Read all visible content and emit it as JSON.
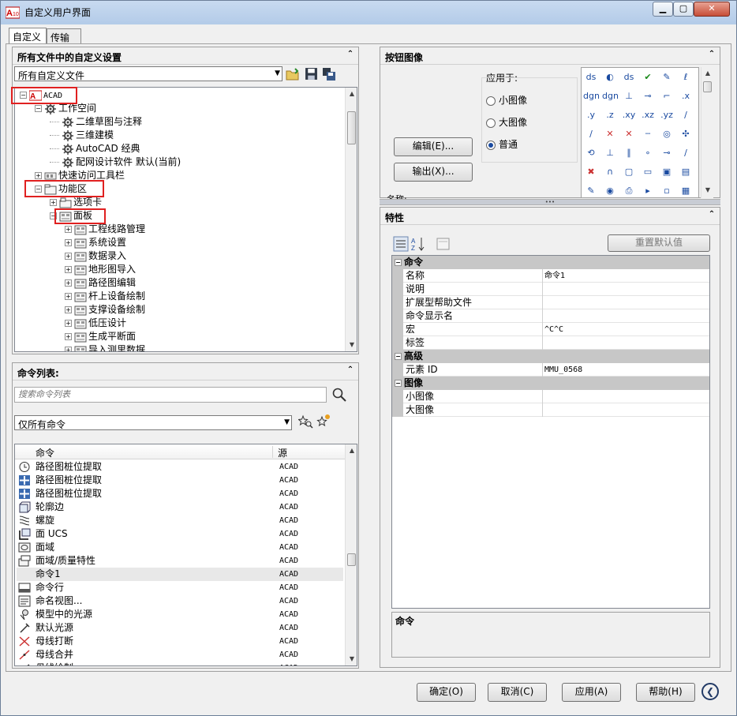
{
  "window": {
    "title": "自定义用户界面",
    "min_symbol": "▁",
    "max_symbol": "▢",
    "close_symbol": "✕"
  },
  "tabs": [
    {
      "label": "自定义",
      "active": true
    },
    {
      "label": "传输",
      "active": false
    }
  ],
  "customizations_panel": {
    "title": "所有文件中的自定义设置",
    "collapse_symbol": "⌃",
    "file_combo_value": "所有自定义文件",
    "tree": [
      {
        "label": "ACAD",
        "level": 0,
        "expander": "−",
        "icon": "acad-logo-icon"
      },
      {
        "label": "工作空间",
        "level": 1,
        "expander": "−",
        "icon": "gear-icon"
      },
      {
        "label": "二维草图与注释",
        "level": 2,
        "expander": "",
        "icon": "gear-icon"
      },
      {
        "label": "三维建模",
        "level": 2,
        "expander": "",
        "icon": "gear-icon"
      },
      {
        "label": "AutoCAD 经典",
        "level": 2,
        "expander": "",
        "icon": "gear-icon"
      },
      {
        "label": "配网设计软件 默认(当前)",
        "level": 2,
        "expander": "",
        "icon": "gear-icon"
      },
      {
        "label": "快速访问工具栏",
        "level": 1,
        "expander": "+",
        "icon": "toolbar-icon"
      },
      {
        "label": "功能区",
        "level": 1,
        "expander": "−",
        "icon": "folder-icon"
      },
      {
        "label": "选项卡",
        "level": 2,
        "expander": "+",
        "icon": "tab-icon"
      },
      {
        "label": "面板",
        "level": 2,
        "expander": "−",
        "icon": "panel-icon"
      },
      {
        "label": "工程线路管理",
        "level": 3,
        "expander": "+",
        "icon": "panel-icon"
      },
      {
        "label": "系统设置",
        "level": 3,
        "expander": "+",
        "icon": "panel-icon"
      },
      {
        "label": "数据录入",
        "level": 3,
        "expander": "+",
        "icon": "panel-icon"
      },
      {
        "label": "地形图导入",
        "level": 3,
        "expander": "+",
        "icon": "panel-icon"
      },
      {
        "label": "路径图编辑",
        "level": 3,
        "expander": "+",
        "icon": "panel-icon"
      },
      {
        "label": "杆上设备绘制",
        "level": 3,
        "expander": "+",
        "icon": "panel-icon"
      },
      {
        "label": "支撑设备绘制",
        "level": 3,
        "expander": "+",
        "icon": "panel-icon"
      },
      {
        "label": "低压设计",
        "level": 3,
        "expander": "+",
        "icon": "panel-icon"
      },
      {
        "label": "生成平断面",
        "level": 3,
        "expander": "+",
        "icon": "panel-icon"
      },
      {
        "label": "导入测里数据",
        "level": 3,
        "expander": "+",
        "icon": "panel-icon"
      }
    ]
  },
  "command_list_panel": {
    "title": "命令列表:",
    "collapse_symbol": "⌃",
    "search_placeholder": "搜索命令列表",
    "filter_value": "仅所有命令",
    "col_command": "命令",
    "col_source": "源",
    "rows": [
      {
        "name": "路径图桩位提取",
        "source": "ACAD",
        "icon": "clock-icon"
      },
      {
        "name": "路径图桩位提取",
        "source": "ACAD",
        "icon": "move-icon"
      },
      {
        "name": "路径图桩位提取",
        "source": "ACAD",
        "icon": "move-icon"
      },
      {
        "name": "轮廓边",
        "source": "ACAD",
        "icon": "box-icon"
      },
      {
        "name": "螺旋",
        "source": "ACAD",
        "icon": "helix-icon"
      },
      {
        "name": "面 UCS",
        "source": "ACAD",
        "icon": "ucs-icon"
      },
      {
        "name": "面域",
        "source": "ACAD",
        "icon": "region-icon"
      },
      {
        "name": "面域/质量特性",
        "source": "ACAD",
        "icon": "massprop-icon"
      },
      {
        "name": "命令1",
        "source": "ACAD",
        "icon": ""
      },
      {
        "name": "命令行",
        "source": "ACAD",
        "icon": "cmdline-icon"
      },
      {
        "name": "命名视图...",
        "source": "ACAD",
        "icon": "view-icon"
      },
      {
        "name": "模型中的光源",
        "source": "ACAD",
        "icon": "light-icon"
      },
      {
        "name": "默认光源",
        "source": "ACAD",
        "icon": "lamp-icon"
      },
      {
        "name": "母线打断",
        "source": "ACAD",
        "icon": "break-icon"
      },
      {
        "name": "母线合并",
        "source": "ACAD",
        "icon": "join-icon"
      },
      {
        "name": "母线绘制",
        "source": "ACAD",
        "icon": "draw-icon"
      }
    ],
    "selected_index": 8
  },
  "button_image_panel": {
    "title": "按钮图像",
    "collapse_symbol": "⌃",
    "apply_to_label": "应用于:",
    "options": [
      {
        "label": "小图像",
        "checked": false
      },
      {
        "label": "大图像",
        "checked": false
      },
      {
        "label": "普通",
        "checked": true
      }
    ],
    "edit_button": "编辑(E)...",
    "export_button": "输出(X)...",
    "name_label": "名称:",
    "splitter_symbol": "•••",
    "icon_grid": [
      [
        "ds",
        "◐",
        "ds",
        "✔",
        "✎",
        "ℓ"
      ],
      [
        "dgn",
        "dgn",
        "⊥",
        "⊸",
        "⌐",
        ".x"
      ],
      [
        ".y",
        ".z",
        ".xy",
        ".xz",
        ".yz",
        "∕"
      ],
      [
        "∕",
        "✕",
        "✕",
        "┄",
        "◎",
        "✣"
      ],
      [
        "⟲",
        "⊥",
        "∥",
        "∘",
        "⊸",
        "∕"
      ],
      [
        "✖",
        "∩",
        "▢",
        "▭",
        "▣",
        "▤"
      ],
      [
        "✎",
        "◉",
        "⎙",
        "▸",
        "▫",
        "▦"
      ]
    ]
  },
  "properties_panel": {
    "title": "特性",
    "collapse_symbol": "⌃",
    "reset_button": "重置默认值",
    "categories": [
      {
        "name": "命令",
        "props": [
          {
            "key": "名称",
            "value": "命令1"
          },
          {
            "key": "说明",
            "value": ""
          },
          {
            "key": "扩展型帮助文件",
            "value": ""
          },
          {
            "key": "命令显示名",
            "value": ""
          },
          {
            "key": "宏",
            "value": "^C^C"
          },
          {
            "key": "标签",
            "value": ""
          }
        ]
      },
      {
        "name": "高级",
        "props": [
          {
            "key": "元素 ID",
            "value": "MMU_0568"
          }
        ]
      },
      {
        "name": "图像",
        "props": [
          {
            "key": "小图像",
            "value": ""
          },
          {
            "key": "大图像",
            "value": ""
          }
        ]
      }
    ],
    "description_title": "命令"
  },
  "footer": {
    "ok": "确定(O)",
    "cancel": "取消(C)",
    "apply": "应用(A)",
    "help": "帮助(H)",
    "nav_symbol": "❮"
  },
  "colors": {
    "highlight_red": "#e02020",
    "category_gray": "#c7c7c7",
    "selected_row": "#e8e8e8"
  }
}
